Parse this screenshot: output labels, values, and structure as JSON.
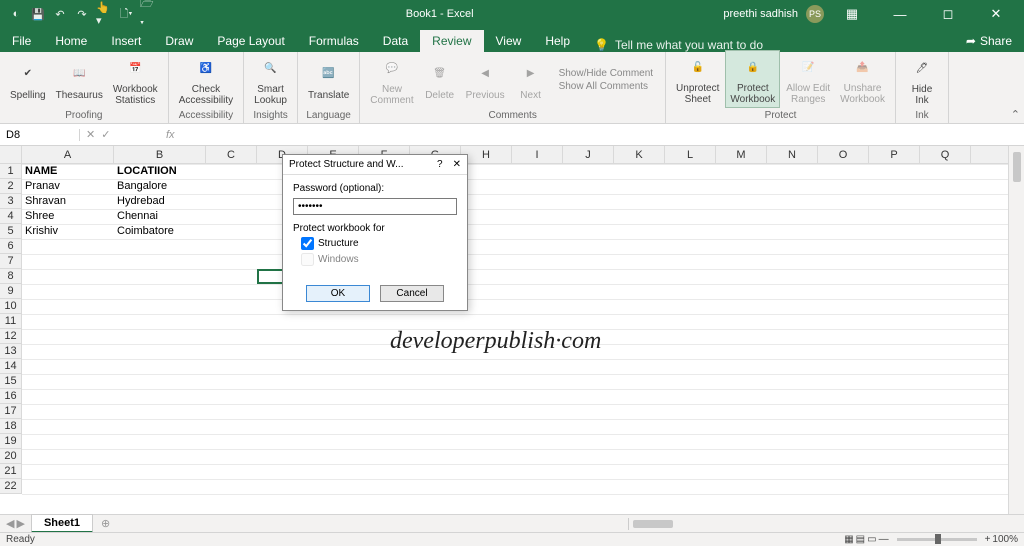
{
  "titlebar": {
    "title": "Book1 - Excel",
    "user_name": "preethi sadhish",
    "user_initials": "PS"
  },
  "tabs": {
    "file": "File",
    "home": "Home",
    "insert": "Insert",
    "draw": "Draw",
    "page_layout": "Page Layout",
    "formulas": "Formulas",
    "data": "Data",
    "review": "Review",
    "view": "View",
    "help": "Help",
    "tell_me": "Tell me what you want to do",
    "share": "Share"
  },
  "ribbon": {
    "spelling": "Spelling",
    "thesaurus": "Thesaurus",
    "wbstats": "Workbook\nStatistics",
    "proofing": "Proofing",
    "check_acc": "Check\nAccessibility",
    "accessibility": "Accessibility",
    "smart_lookup": "Smart\nLookup",
    "insights": "Insights",
    "translate": "Translate",
    "language": "Language",
    "new_comment": "New\nComment",
    "delete": "Delete",
    "previous": "Previous",
    "next": "Next",
    "showhide": "Show/Hide Comment",
    "showall": "Show All Comments",
    "comments": "Comments",
    "unprotect_sheet": "Unprotect\nSheet",
    "protect_wb": "Protect\nWorkbook",
    "allow_edit": "Allow Edit\nRanges",
    "unshare_wb": "Unshare\nWorkbook",
    "protect": "Protect",
    "hide_ink": "Hide\nInk",
    "ink": "Ink"
  },
  "namebox": {
    "value": "D8"
  },
  "columns": [
    "A",
    "B",
    "C",
    "D",
    "E",
    "F",
    "G",
    "H",
    "I",
    "J",
    "K",
    "L",
    "M",
    "N",
    "O",
    "P",
    "Q"
  ],
  "cells": {
    "a1": "NAME",
    "b1": "LOCATIION",
    "a2": "Pranav",
    "b2": "Bangalore",
    "a3": "Shravan",
    "b3": "Hydrebad",
    "a4": "Shree",
    "b4": "Chennai",
    "a5": "Krishiv",
    "b5": "Coimbatore"
  },
  "dialog": {
    "title": "Protect Structure and W...",
    "pw_label": "Password (optional):",
    "pw_value": "•••••••",
    "section": "Protect workbook for",
    "structure": "Structure",
    "windows": "Windows",
    "ok": "OK",
    "cancel": "Cancel"
  },
  "sheet": {
    "name": "Sheet1"
  },
  "status": {
    "ready": "Ready",
    "zoom": "100%"
  },
  "watermark": "developerpublish·com"
}
